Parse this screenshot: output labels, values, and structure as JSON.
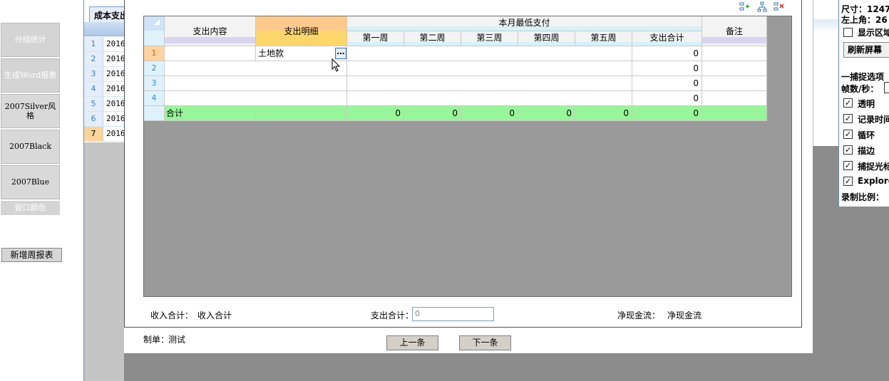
{
  "left_panel": {
    "buttons": [
      "分组统计",
      "生成Word报表",
      "2007Silver风格",
      "2007Black",
      "2007Blue"
    ],
    "window_color": "窗口颜色",
    "new_weekly_report": "新增周报表"
  },
  "background_sheet": {
    "tab_label": "成本支出",
    "rows": [
      {
        "num": "1",
        "value": "2016"
      },
      {
        "num": "2",
        "value": "2016"
      },
      {
        "num": "3",
        "value": "2016"
      },
      {
        "num": "4",
        "value": "2016"
      },
      {
        "num": "5",
        "value": "2016"
      },
      {
        "num": "6",
        "value": "2016"
      },
      {
        "num": "7",
        "value": "2016"
      }
    ]
  },
  "table": {
    "headers": {
      "content": "支出内容",
      "detail": "支出明细",
      "group": "本月最低支付",
      "weeks": [
        "第一周",
        "第二周",
        "第三周",
        "第四周",
        "第五周"
      ],
      "total": "支出合计",
      "note": "备注"
    },
    "rows": [
      {
        "num": "1",
        "content": "",
        "detail": "土地款",
        "total": "0"
      },
      {
        "num": "2",
        "content": "",
        "detail": "",
        "total": "0"
      },
      {
        "num": "3",
        "content": "",
        "detail": "",
        "total": "0"
      },
      {
        "num": "4",
        "content": "",
        "detail": "",
        "total": "0"
      }
    ],
    "summary": {
      "label": "合计",
      "week_values": [
        "0",
        "0",
        "0",
        "0",
        "0"
      ],
      "total": "0"
    },
    "ellipsis_button": "…"
  },
  "footer": {
    "income_label": "收入合计：",
    "income_value": "收入合计",
    "expense_label": "支出合计：",
    "expense_value": "0",
    "net_label": "净现金流：",
    "net_value": "净现金流",
    "creator_label": "制单：",
    "creator_value": "测试",
    "prev_button": "上一条",
    "next_button": "下一条"
  },
  "right_panel": {
    "size_label": "尺寸：1247",
    "topleft_label": "左上角：26",
    "show_region": "显示区域",
    "refresh_button": "刷新屏幕",
    "capture_options": "一捕捉选项",
    "fps_label": "帧数/秒：",
    "options": [
      {
        "label": "透明",
        "checked": true
      },
      {
        "label": "记录时间",
        "checked": true
      },
      {
        "label": "循环",
        "checked": true
      },
      {
        "label": "描边",
        "checked": true
      },
      {
        "label": "捕捉光标",
        "checked": true
      },
      {
        "label": "Explorer",
        "checked": true
      }
    ],
    "ratio_label": "录制比例："
  },
  "icons": [
    "insert-row-icon",
    "tree-icon",
    "delete-row-icon",
    "cursor-arrow-icon"
  ]
}
